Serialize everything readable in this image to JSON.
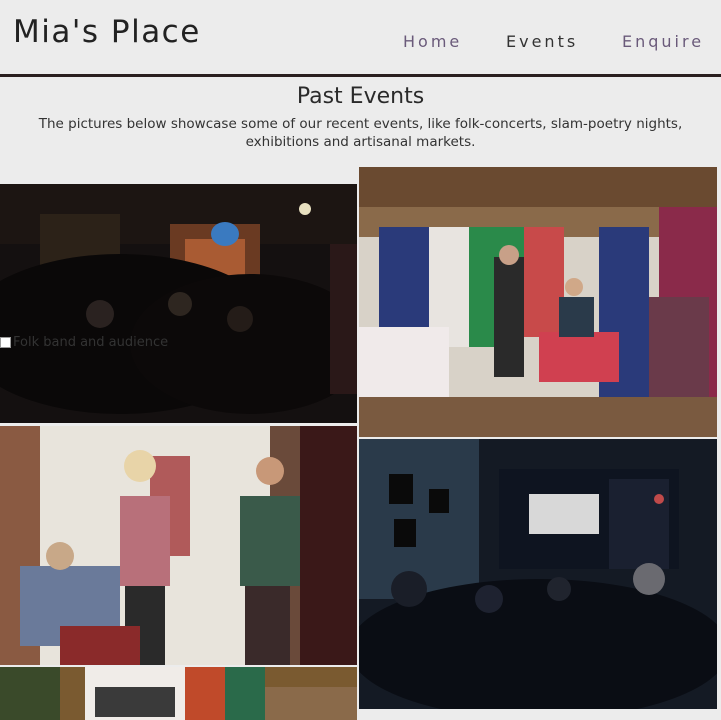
{
  "header": {
    "logo": "Mia's Place",
    "nav": [
      {
        "label": "Home"
      },
      {
        "label": "Events"
      },
      {
        "label": "Enquire"
      }
    ]
  },
  "main": {
    "title": "Past Events",
    "description": "The pictures below showcase some of our recent events, like folk-concerts, slam-poetry nights, exhibitions and artisanal markets."
  },
  "gallery": {
    "photos": [
      {
        "alt": "Folk band and audience"
      }
    ]
  }
}
